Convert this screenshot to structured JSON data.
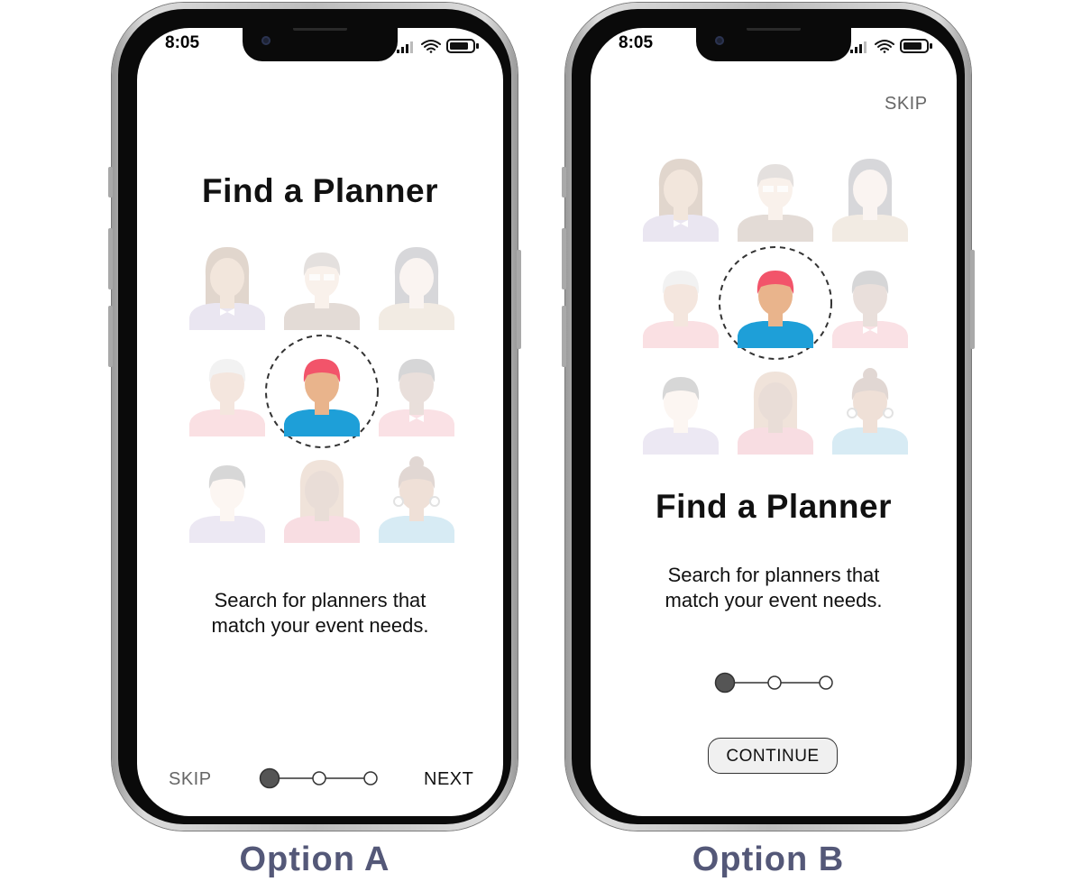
{
  "option_a": {
    "label": "Option A",
    "status_time": "8:05",
    "title": "Find a Planner",
    "subtitle_lines": [
      "Search for planners that",
      "match your event needs."
    ],
    "skip_label": "SKIP",
    "next_label": "NEXT",
    "step": {
      "current": 1,
      "total": 3
    }
  },
  "option_b": {
    "label": "Option B",
    "status_time": "8:05",
    "title": "Find a Planner",
    "subtitle_lines": [
      "Search for planners that",
      "match your event needs."
    ],
    "skip_label": "SKIP",
    "continue_label": "CONTINUE",
    "step": {
      "current": 1,
      "total": 3
    }
  },
  "colors": {
    "label_color": "#545878",
    "highlight_hair": "#f2546a",
    "highlight_shirt": "#1e9fd8",
    "step_active": "#555555"
  },
  "icons": [
    "signal-icon",
    "wifi-icon",
    "battery-icon",
    "planner-avatar-icon"
  ]
}
